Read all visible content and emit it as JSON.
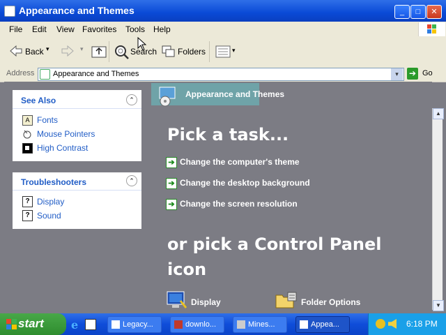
{
  "window": {
    "title": "Appearance and Themes",
    "buttons": {
      "minimize": "_",
      "maximize": "□",
      "close": "✕"
    }
  },
  "menu": [
    "File",
    "Edit",
    "View",
    "Favorites",
    "Tools",
    "Help"
  ],
  "toolbar": {
    "back": "Back",
    "search": "Search",
    "folders": "Folders"
  },
  "address": {
    "label": "Address",
    "value": "Appearance and Themes",
    "go": "Go"
  },
  "left": {
    "see_also": {
      "title": "See Also",
      "items": [
        "Fonts",
        "Mouse Pointers",
        "High Contrast"
      ]
    },
    "troubleshooters": {
      "title": "Troubleshooters",
      "items": [
        "Display",
        "Sound"
      ]
    }
  },
  "right": {
    "header": "Appearance and Themes",
    "pick_task": "Pick a task...",
    "tasks": [
      "Change the computer's theme",
      "Change the desktop background",
      "Change the screen resolution"
    ],
    "or_pick_line1": "or pick a Control Panel",
    "or_pick_line2": "icon",
    "icons": [
      "Display",
      "Folder Options"
    ]
  },
  "taskbar": {
    "start": "start",
    "tasks": [
      "Legacy...",
      "downlo...",
      "Mines...",
      "Appea..."
    ],
    "clock": "6:18 PM"
  }
}
